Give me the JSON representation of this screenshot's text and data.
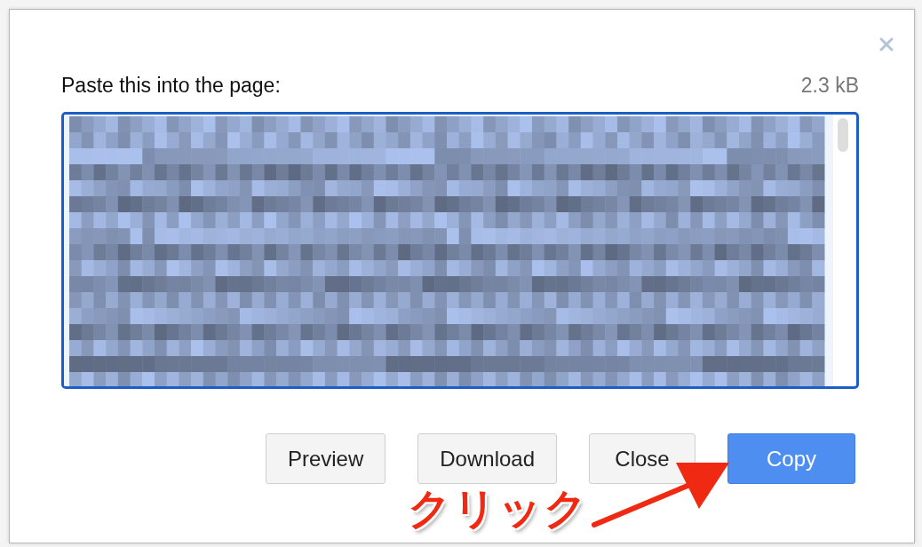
{
  "dialog": {
    "title": "Paste this into the page:",
    "size": "2.3 kB",
    "buttons": [
      {
        "label": "Preview",
        "kind": "default"
      },
      {
        "label": "Download",
        "kind": "default"
      },
      {
        "label": "Close",
        "kind": "default"
      },
      {
        "label": "Copy",
        "kind": "primary"
      }
    ]
  },
  "annotation": {
    "text": "クリック"
  }
}
